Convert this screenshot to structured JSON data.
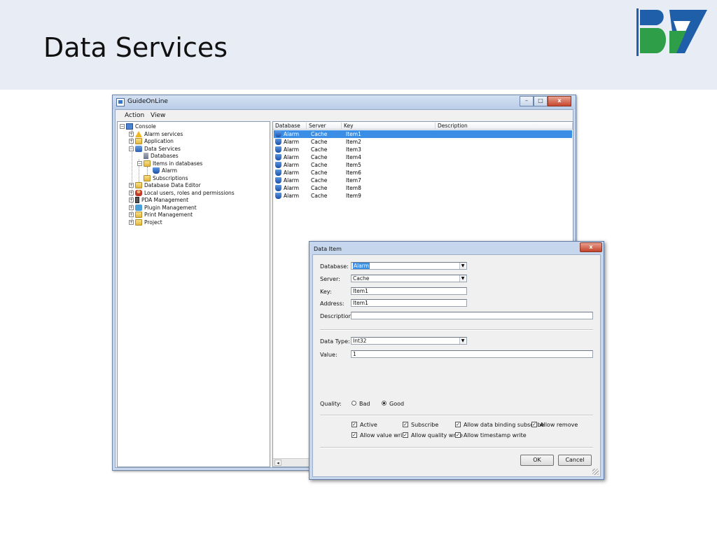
{
  "slide": {
    "title": "Data Services"
  },
  "window": {
    "title": "GuideOnLine",
    "controls": {
      "minimize": "–",
      "maximize": "□",
      "close": "x"
    }
  },
  "menu": {
    "action": "Action",
    "view": "View"
  },
  "tree": {
    "items": [
      {
        "label": "Console",
        "icon": "console-icon"
      },
      {
        "label": "Alarm services",
        "icon": "warning-icon"
      },
      {
        "label": "Application",
        "icon": "folder-icon"
      },
      {
        "label": "Data Services",
        "icon": "database-icon"
      },
      {
        "label": "Databases",
        "icon": "database-small-icon"
      },
      {
        "label": "Items in databases",
        "icon": "folder-icon"
      },
      {
        "label": "Alarm",
        "icon": "alarm-icon"
      },
      {
        "label": "Subscriptions",
        "icon": "folder-icon"
      },
      {
        "label": "Database Data Editor",
        "icon": "folder-icon"
      },
      {
        "label": "Local users, roles and permissions",
        "icon": "user-icon"
      },
      {
        "label": "PDA Management",
        "icon": "pda-icon"
      },
      {
        "label": "Plugin Management",
        "icon": "plugin-icon"
      },
      {
        "label": "Print Management",
        "icon": "folder-icon"
      },
      {
        "label": "Project",
        "icon": "folder-icon"
      }
    ]
  },
  "list": {
    "columns": [
      "Database",
      "Server",
      "Key",
      "Description"
    ],
    "rows": [
      {
        "database": "Alarm",
        "server": "Cache",
        "key": "Item1",
        "description": ""
      },
      {
        "database": "Alarm",
        "server": "Cache",
        "key": "Item2",
        "description": ""
      },
      {
        "database": "Alarm",
        "server": "Cache",
        "key": "Item3",
        "description": ""
      },
      {
        "database": "Alarm",
        "server": "Cache",
        "key": "Item4",
        "description": ""
      },
      {
        "database": "Alarm",
        "server": "Cache",
        "key": "Item5",
        "description": ""
      },
      {
        "database": "Alarm",
        "server": "Cache",
        "key": "Item6",
        "description": ""
      },
      {
        "database": "Alarm",
        "server": "Cache",
        "key": "Item7",
        "description": ""
      },
      {
        "database": "Alarm",
        "server": "Cache",
        "key": "Item8",
        "description": ""
      },
      {
        "database": "Alarm",
        "server": "Cache",
        "key": "Item9",
        "description": ""
      }
    ],
    "selected_row": 0
  },
  "dialog": {
    "title": "Data Item",
    "close": "x",
    "database_label": "Database:",
    "database_value": "Alarm",
    "server_label": "Server:",
    "server_value": "Cache",
    "key_label": "Key:",
    "key_value": "Item1",
    "address_label": "Address:",
    "address_value": "Item1",
    "description_label": "Description:",
    "description_value": "",
    "datatype_label": "Data Type:",
    "datatype_value": "Int32",
    "value_label": "Value:",
    "value_value": "1",
    "quality_label": "Quality:",
    "quality_bad": "Bad",
    "quality_good": "Good",
    "quality_selected": "Good",
    "checkboxes": {
      "active": {
        "label": "Active",
        "checked": true
      },
      "subscribe": {
        "label": "Subscribe",
        "checked": true
      },
      "allow_binding": {
        "label": "Allow data binding subscribe",
        "checked": true
      },
      "allow_remove": {
        "label": "Allow remove",
        "checked": true
      },
      "allow_value_write": {
        "label": "Allow value write",
        "checked": true
      },
      "allow_quality_write": {
        "label": "Allow quality write",
        "checked": true
      },
      "allow_timestamp_write": {
        "label": "Allow timestamp write",
        "checked": true
      }
    },
    "ok_label": "OK",
    "cancel_label": "Cancel"
  },
  "colors": {
    "header_bg": "#e8ecf5",
    "selection": "#3a8ee6",
    "logo_blue": "#1f5ea8",
    "logo_green": "#2e9e48"
  }
}
